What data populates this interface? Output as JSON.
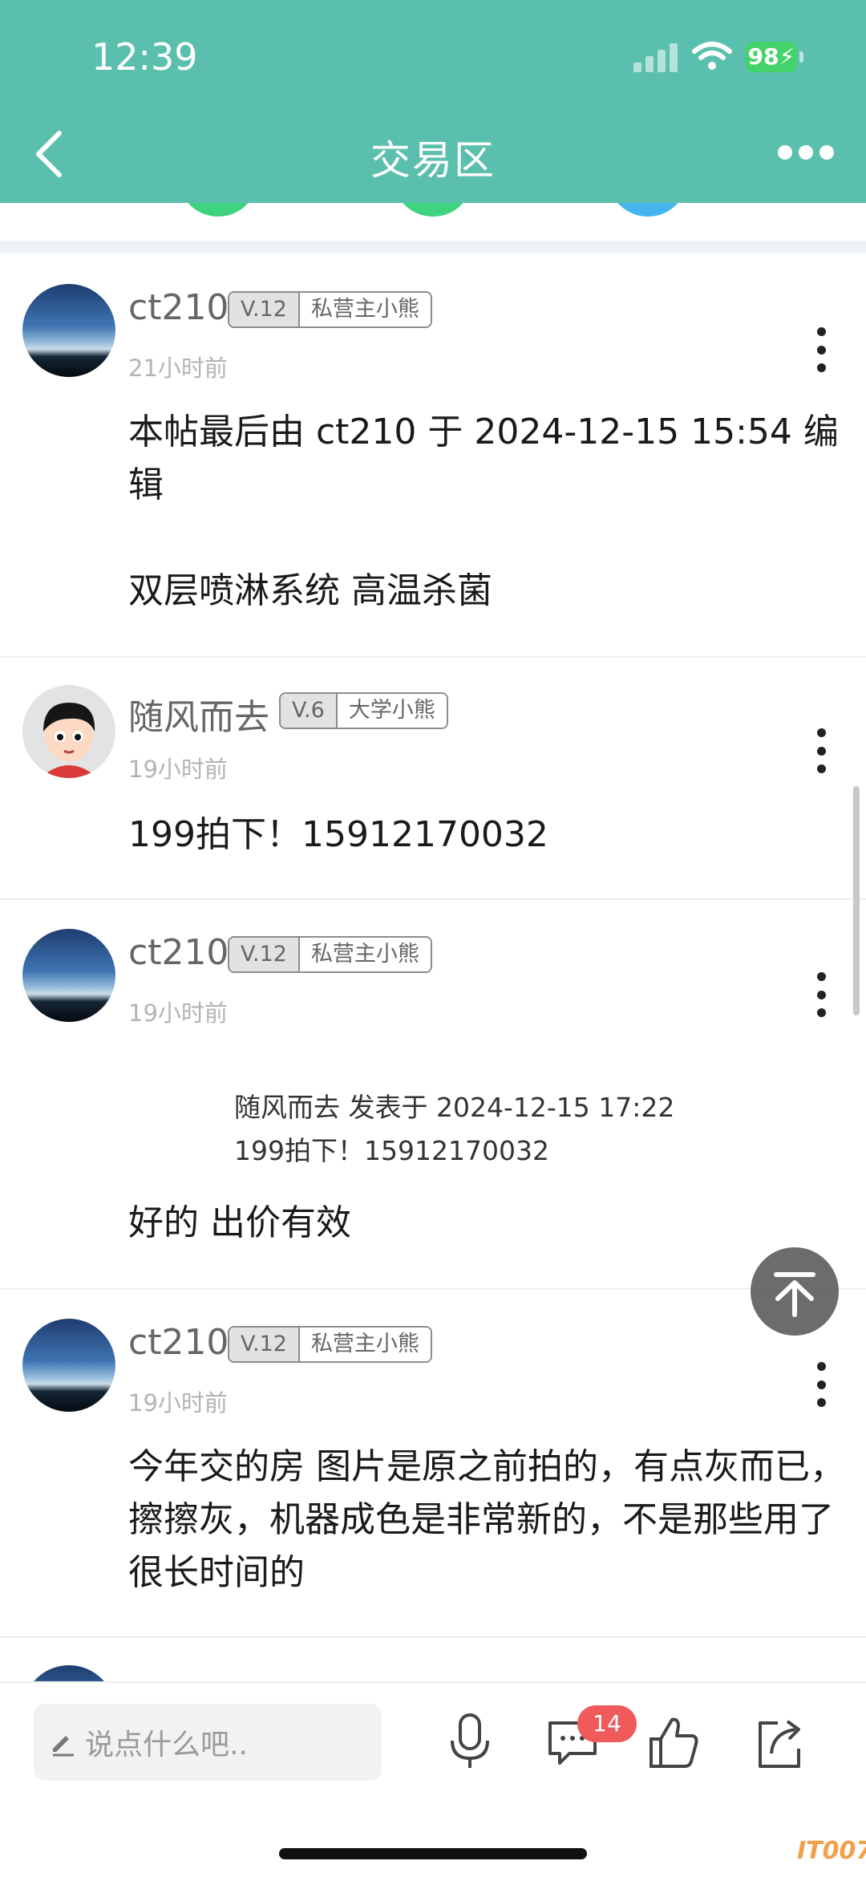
{
  "status_bar": {
    "time": "12:39",
    "battery": "98"
  },
  "nav": {
    "title": "交易区"
  },
  "posts": [
    {
      "username": "ct210",
      "level": "V.12",
      "rank_title": "私营主小熊",
      "time": "21小时前",
      "content": "本帖最后由 ct210 于 2024-12-15 15:54 编辑\n\n双层喷淋系统 高温杀菌"
    },
    {
      "username": "随风而去",
      "level": "V.6",
      "rank_title": "大学小熊",
      "time": "19小时前",
      "content": "199拍下！15912170032"
    },
    {
      "username": "ct210",
      "level": "V.12",
      "rank_title": "私营主小熊",
      "time": "19小时前",
      "quote_line1": "随风而去 发表于 2024-12-15 17:22",
      "quote_line2": "199拍下！15912170032",
      "content": "好的 出价有效"
    },
    {
      "username": "ct210",
      "level": "V.12",
      "rank_title": "私营主小熊",
      "time": "19小时前",
      "content": "今年交的房 图片是原之前拍的，有点灰而已，擦擦灰，机器成色是非常新的，不是那些用了很长时间的"
    }
  ],
  "bottom_bar": {
    "input_placeholder": "说点什么吧..",
    "comment_count": "14"
  },
  "watermark": "IT007",
  "colors": {
    "header": "#5bbfad",
    "badge_red": "#f05a5a",
    "battery_green": "#44d36a"
  }
}
